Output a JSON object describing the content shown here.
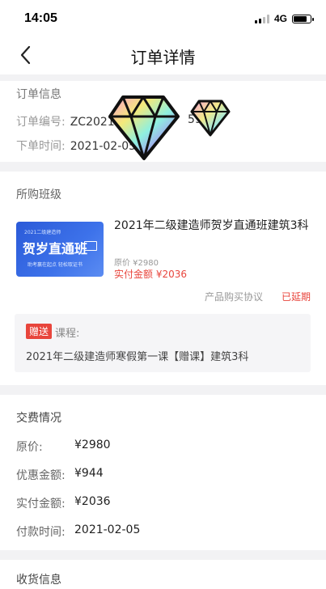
{
  "status_bar": {
    "time": "14:05",
    "network": "4G",
    "battery_level": 0.8
  },
  "nav": {
    "title": "订单详情"
  },
  "order_info": {
    "section_title": "订单信息",
    "order_no_label": "订单编号:",
    "order_no_value": "ZC2021",
    "order_no_suffix": "5929",
    "order_time_label": "下单时间:",
    "order_time_value": "2021-02-05"
  },
  "purchased_class": {
    "section_title": "所购班级",
    "course_image": {
      "top_text": "2021二级建造师",
      "title": "贺岁直通班",
      "sub_text": "助考赢在起点  轻松取证书"
    },
    "course_name": "2021年二级建造师贺岁直通班建筑3科",
    "original_price": "原价 ¥2980",
    "paid_amount": "实付金额 ¥2036",
    "agreement_link": "产品购买协议",
    "status": "已延期",
    "gift": {
      "tag": "赠送",
      "label": "课程:",
      "course": "2021年二级建造师寒假第一课【赠课】建筑3科"
    }
  },
  "payment": {
    "section_title": "交费情况",
    "rows": [
      {
        "label": "原价:",
        "value": "¥2980"
      },
      {
        "label": "优惠金额:",
        "value": "¥944"
      },
      {
        "label": "实付金额:",
        "value": "¥2036"
      },
      {
        "label": "付款时间:",
        "value": "2021-02-05"
      }
    ]
  },
  "shipping": {
    "section_title": "收货信息"
  },
  "colors": {
    "accent_red": "#e8453c",
    "background": "#f2f2f4",
    "gem_outline": "#111111"
  }
}
